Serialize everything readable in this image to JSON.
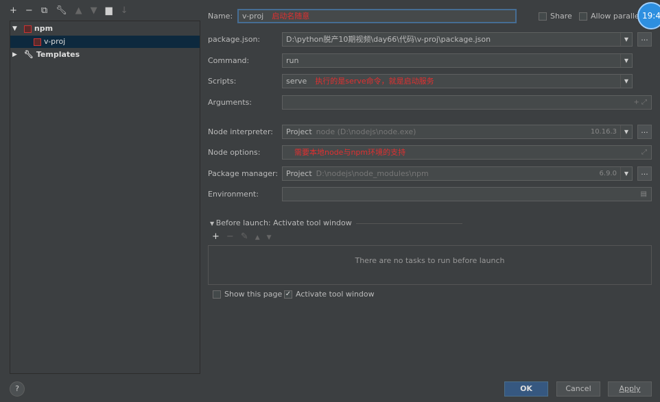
{
  "toolbar": {
    "add": "+",
    "remove": "−",
    "copy": "⧉",
    "edit": "🔧",
    "up": "▲",
    "down": "▼",
    "folder": "▆",
    "sort": "↓"
  },
  "tree": {
    "npm": "npm",
    "vproj": "v-proj",
    "templates": "Templates"
  },
  "form": {
    "name_label": "Name:",
    "name_value": "v-proj",
    "name_note": "启动名随意",
    "share": "Share",
    "allow_parallel": "Allow paralle",
    "package_label": "package.json:",
    "package_value": "D:\\python脱产10期视频\\day66\\代码\\v-proj\\package.json",
    "command_label": "Command:",
    "command_value": "run",
    "scripts_label": "Scripts:",
    "scripts_value": "serve",
    "scripts_note": "执行的是serve命令，就是启动服务",
    "arguments_label": "Arguments:",
    "interp_label": "Node interpreter:",
    "interp_project": "Project",
    "interp_path": "node (D:\\nodejs\\node.exe)",
    "interp_version": "10.16.3",
    "options_label": "Node options:",
    "options_note": "需要本地node与npm环境的支持",
    "pm_label": "Package manager:",
    "pm_project": "Project",
    "pm_path": "D:\\nodejs\\node_modules\\npm",
    "pm_version": "6.9.0",
    "env_label": "Environment:"
  },
  "before_launch": {
    "title": "Before launch: Activate tool window",
    "empty": "There are no tasks to run before launch"
  },
  "options": {
    "show_page": "Show this page",
    "activate": "Activate tool window"
  },
  "buttons": {
    "ok": "OK",
    "cancel": "Cancel",
    "apply": "Apply",
    "help": "?",
    "ellipsis": "..."
  },
  "badge": "19:4"
}
